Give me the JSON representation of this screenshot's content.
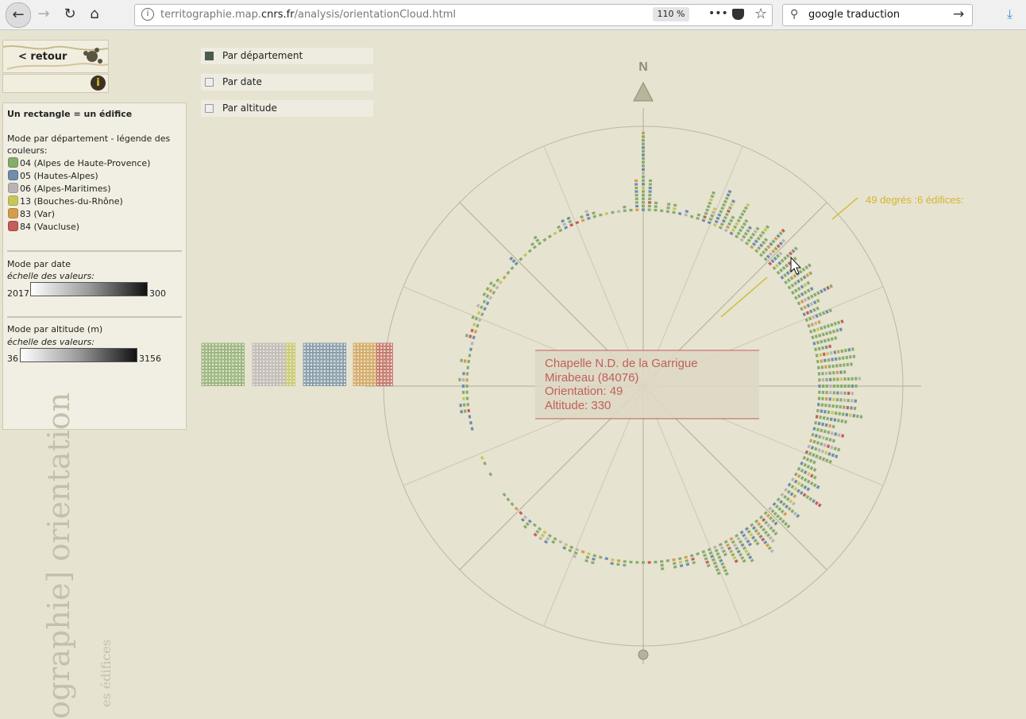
{
  "browser": {
    "url_host": "territographie.map.",
    "url_domain": "cnrs.fr",
    "url_path": "/analysis/orientationCloud.html",
    "zoom": "110 %",
    "search_value": "google traduction"
  },
  "sidebar": {
    "back_label": "< retour",
    "info_label": "i"
  },
  "legend": {
    "heading": "Un rectangle = un édifice",
    "dept_title_1": "Mode par département - légende des",
    "dept_title_2": "couleurs:",
    "departments": [
      {
        "label": "04 (Alpes de Haute-Provence)",
        "color": "#86ad6c"
      },
      {
        "label": "05 (Hautes-Alpes)",
        "color": "#6e8eaa"
      },
      {
        "label": "06 (Alpes-Maritimes)",
        "color": "#b9b3b6"
      },
      {
        "label": "13 (Bouches-du-Rhône)",
        "color": "#c6c758"
      },
      {
        "label": "83 (Var)",
        "color": "#d39d4b"
      },
      {
        "label": "84 (Vaucluse)",
        "color": "#c45e5a"
      }
    ],
    "date_title": "Mode par date",
    "date_scale_label": "échelle des valeurs:",
    "date_min": "2017",
    "date_max": "300",
    "alt_title": "Mode par altitude (m)",
    "alt_scale_label": "échelle des valeurs:",
    "alt_min": "36",
    "alt_max": "3156"
  },
  "options": [
    {
      "label": "Par département",
      "checked": true
    },
    {
      "label": "Par date",
      "checked": false
    },
    {
      "label": "Par altitude",
      "checked": false
    }
  ],
  "compass": {
    "north_label": "N",
    "hover_orientation_deg": 49,
    "hover_label": "49 degrés :6 édifices:"
  },
  "tooltip": {
    "name": "Chapelle N.D. de la Garrigue",
    "commune": "Mirabeau (84076)",
    "orientation": "Orientation: 49",
    "altitude": "Altitude: 330"
  },
  "vertical_title": "ographie] orientation",
  "vertical_subtitle": "es édifices"
}
